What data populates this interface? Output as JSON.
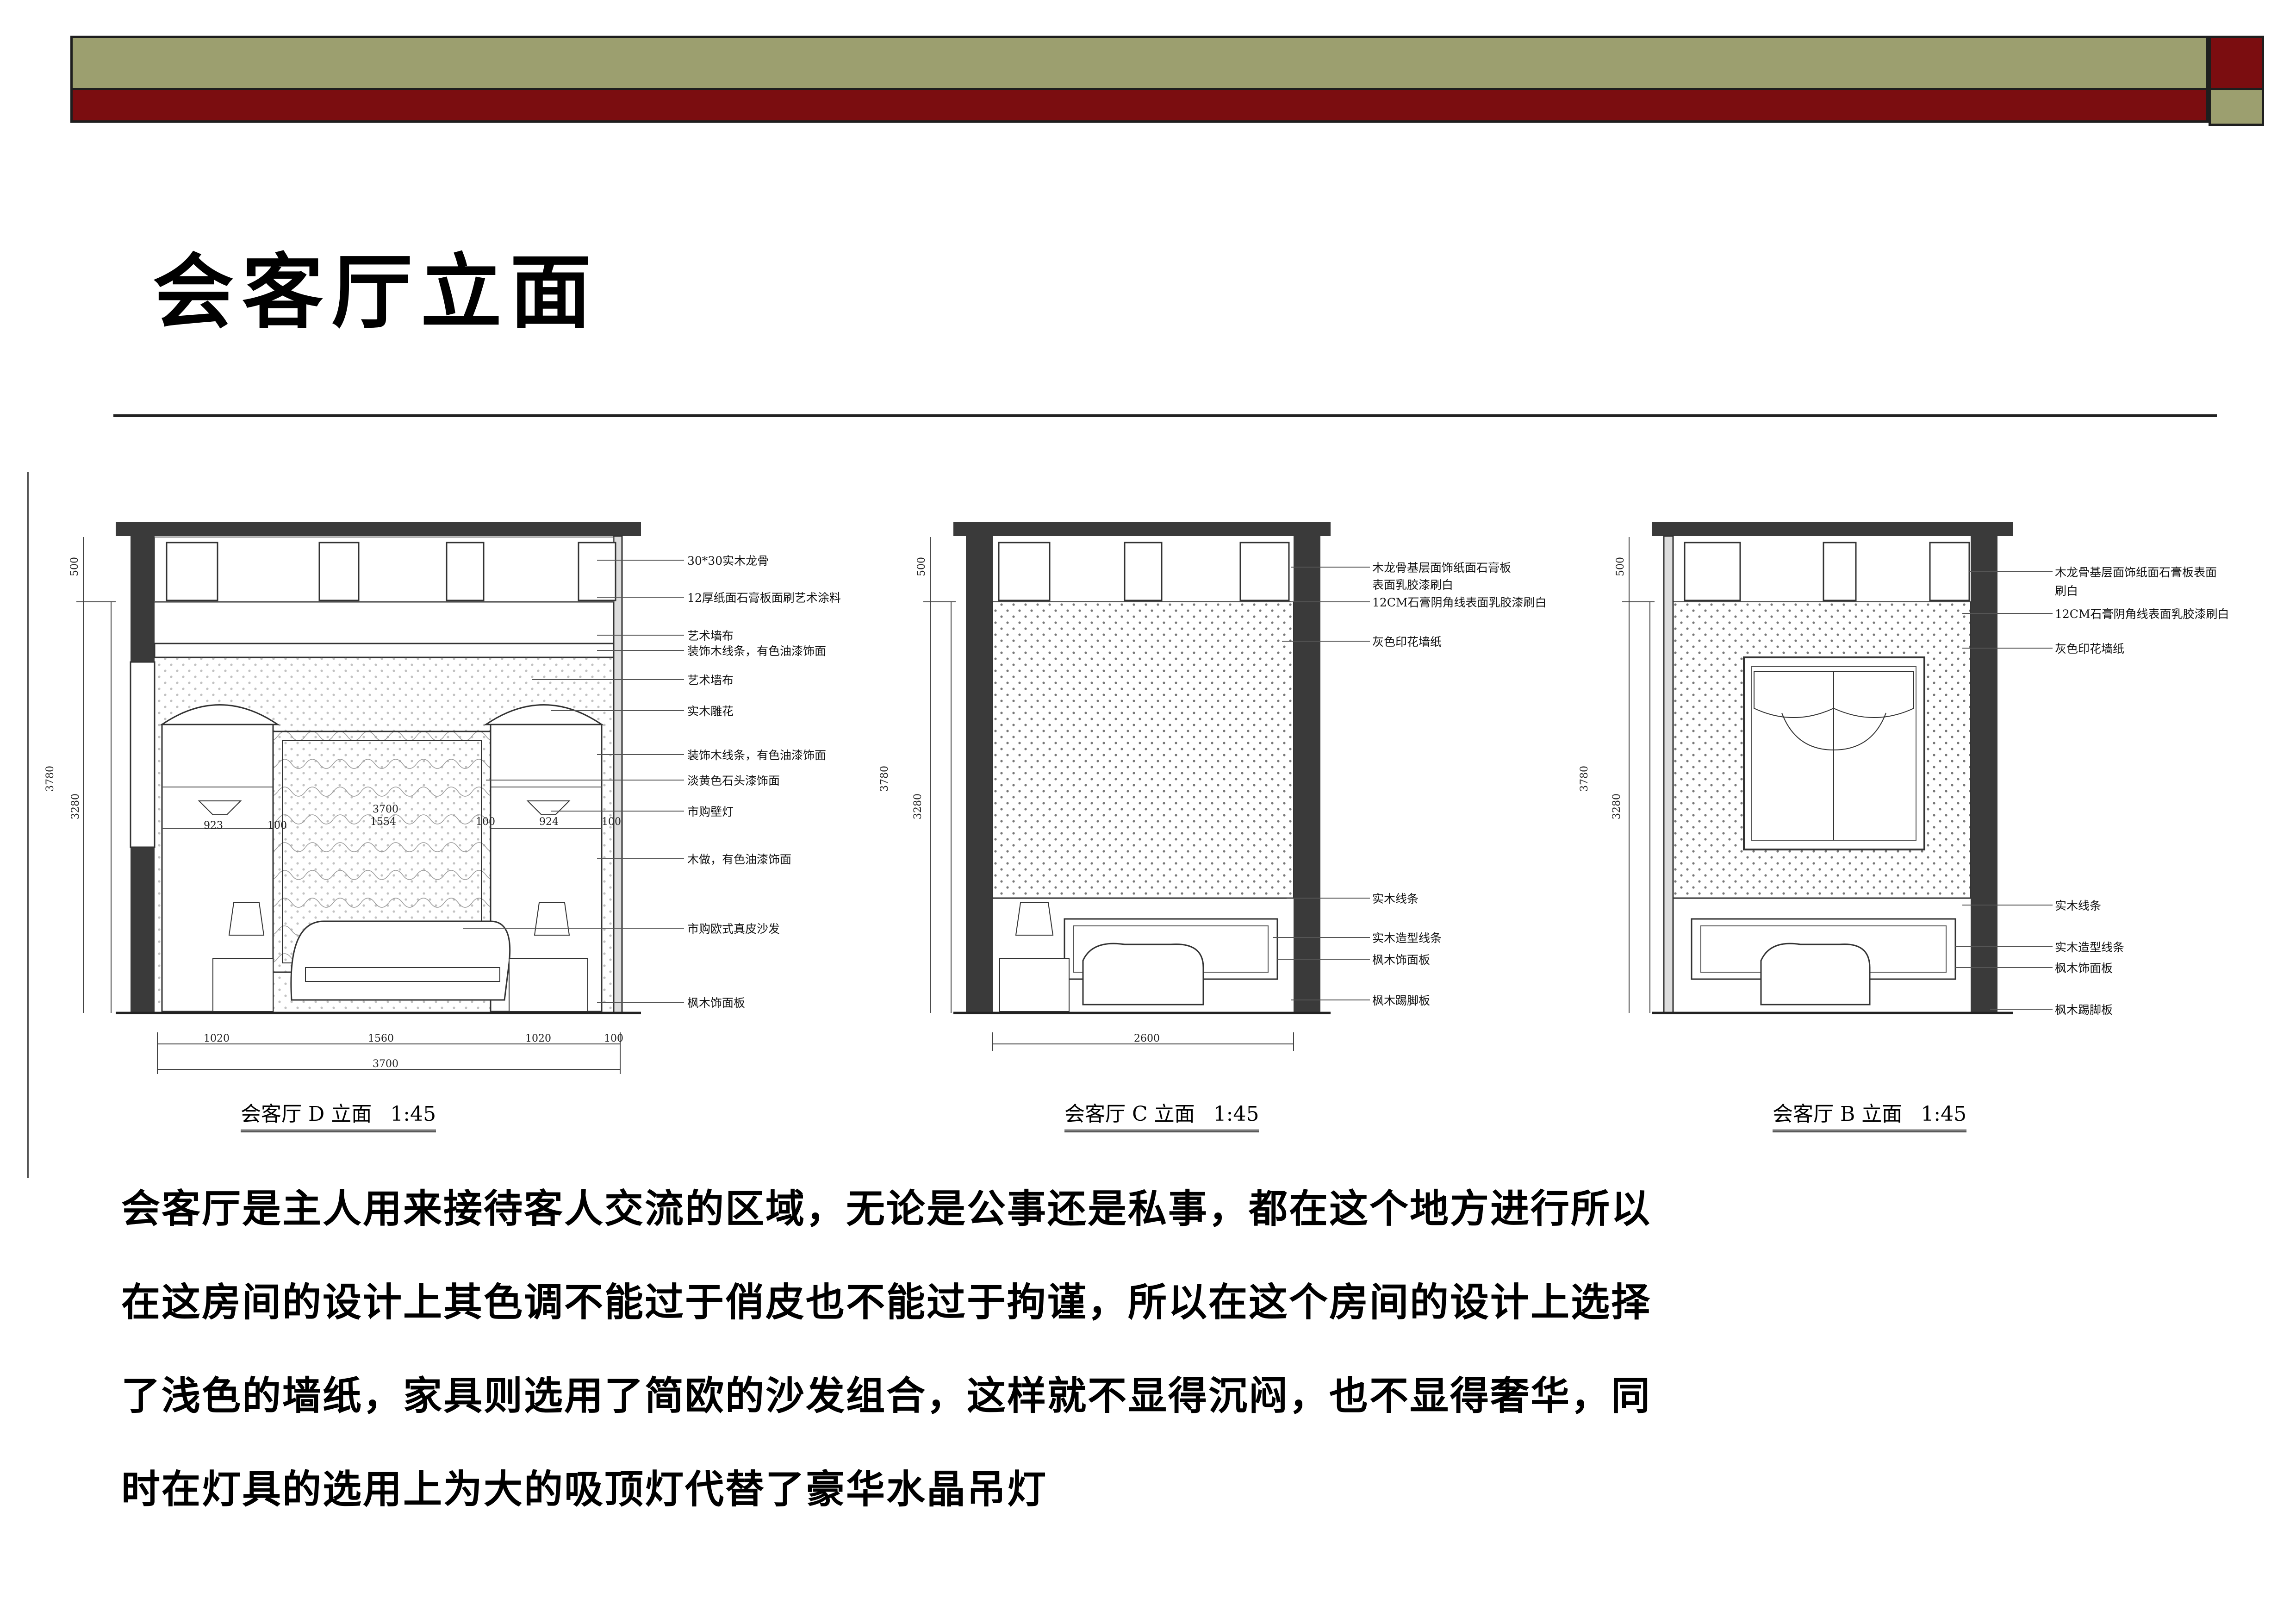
{
  "header": {
    "title": "会客厅立面"
  },
  "colors": {
    "olive_band": "#9c9f6f",
    "maroon_band": "#7b0d10",
    "wall_dark": "#3a3a3a"
  },
  "elevations": [
    {
      "caption_label": "会客厅 D 立面",
      "caption_scale": "1:45",
      "left_dims": [
        "500",
        "3780",
        "3280"
      ],
      "inner_dims": [
        "3700",
        "1554",
        "923",
        "924",
        "100",
        "100",
        "100",
        "100"
      ],
      "bottom_dims": [
        "1020",
        "1560",
        "1020",
        "100"
      ],
      "total_dim": "3700",
      "annotations": [
        "30*30实木龙骨",
        "12厚纸面石膏板面刷艺术涂料",
        "艺术墙布",
        "装饰木线条，有色油漆饰面",
        "艺术墙布",
        "实木雕花",
        "装饰木线条，有色油漆饰面",
        "淡黄色石头漆饰面",
        "市购壁灯",
        "木做，有色油漆饰面",
        "市购欧式真皮沙发",
        "枫木饰面板"
      ]
    },
    {
      "caption_label": "会客厅 C 立面",
      "caption_scale": "1:45",
      "left_dims": [
        "500",
        "3780",
        "3280"
      ],
      "bottom_dims": [
        "2600"
      ],
      "annotations": [
        "木龙骨基层面饰纸面石膏板",
        "表面乳胶漆刷白",
        "12CM石膏阴角线表面乳胶漆刷白",
        "灰色印花墙纸",
        "实木线条",
        "实木造型线条",
        "枫木饰面板",
        "枫木踢脚板"
      ]
    },
    {
      "caption_label": "会客厅 B 立面",
      "caption_scale": "1:45",
      "left_dims": [
        "500",
        "3780",
        "3280"
      ],
      "annotations": [
        "木龙骨基层面饰纸面石膏板表面",
        "刷白",
        "12CM石膏阴角线表面乳胶漆刷白",
        "灰色印花墙纸",
        "实木线条",
        "实木造型线条",
        "枫木饰面板",
        "枫木踢脚板"
      ]
    }
  ],
  "description": {
    "lines": [
      "会客厅是主人用来接待客人交流的区域，无论是公事还是私事，都在这个地方进行所以",
      "在这房间的设计上其色调不能过于俏皮也不能过于拘谨，所以在这个房间的设计上选择",
      "了浅色的墙纸，家具则选用了简欧的沙发组合，这样就不显得沉闷，也不显得奢华，同",
      "时在灯具的选用上为大的吸顶灯代替了豪华水晶吊灯"
    ]
  }
}
